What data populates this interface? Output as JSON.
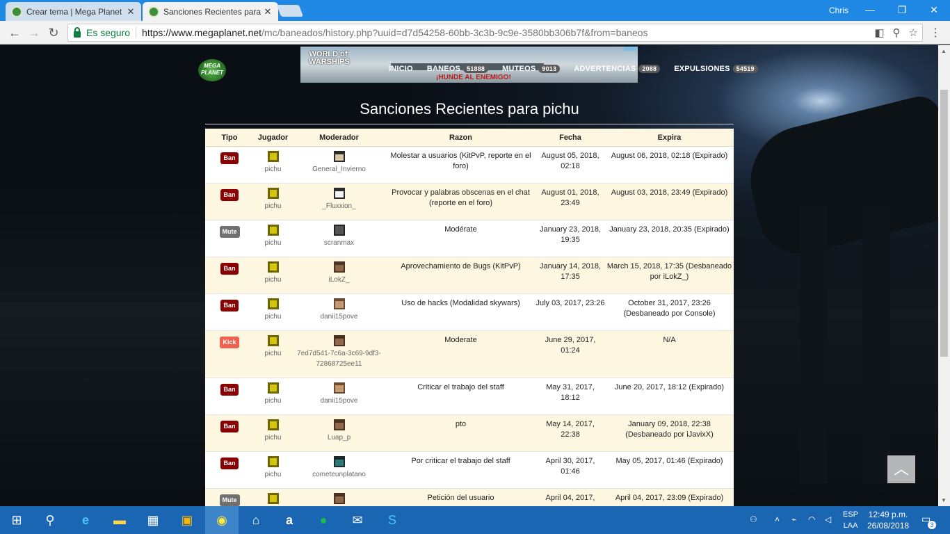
{
  "browser": {
    "tabs": [
      {
        "title": "Crear tema | Mega Planet",
        "close": "✕"
      },
      {
        "title": "Sanciones Recientes para",
        "close": "✕"
      }
    ],
    "user": "Chris",
    "window_controls": {
      "minimize": "—",
      "maximize": "❐",
      "close": "✕"
    },
    "nav": {
      "back": "←",
      "forward": "→",
      "reload": "↻"
    },
    "secure_label": "Es seguro",
    "url_host": "https://www.megaplanet.net",
    "url_path": "/mc/baneados/history.php?uuid=d7d54258-60bb-3c3b-9c9e-3580bb306b7f&from=baneos",
    "menu": "⋮"
  },
  "site": {
    "logo_text": "MEGA PLANET",
    "ad": {
      "logo": "WORLD of WARSHIPS",
      "tagline": "¡HUNDE AL ENEMIGO!"
    },
    "nav": [
      {
        "label": "INICIO",
        "count": ""
      },
      {
        "label": "BANEOS",
        "count": "51888"
      },
      {
        "label": "MUTEOS",
        "count": "9013"
      },
      {
        "label": "ADVERTENCIAS",
        "count": "2088"
      },
      {
        "label": "EXPULSIONES",
        "count": "54519"
      }
    ]
  },
  "page": {
    "title": "Sanciones Recientes para pichu",
    "headers": {
      "tipo": "Tipo",
      "jugador": "Jugador",
      "moderador": "Moderador",
      "razon": "Razon",
      "fecha": "Fecha",
      "expira": "Expira"
    },
    "rows": [
      {
        "tipo": "Ban",
        "jugador": "pichu",
        "moderador": "General_Invierno",
        "razon": "Molestar a usuarios (KitPvP, reporte en el foro)",
        "fecha": "August 05, 2018, 02:18",
        "expira": "August 06, 2018, 02:18 (Expirado)"
      },
      {
        "tipo": "Ban",
        "jugador": "pichu",
        "moderador": "_Fluxxion_",
        "razon": "Provocar y palabras obscenas en el chat (reporte en el foro)",
        "fecha": "August 01, 2018, 23:49",
        "expira": "August 03, 2018, 23:49 (Expirado)"
      },
      {
        "tipo": "Mute",
        "jugador": "pichu",
        "moderador": "scranmax",
        "razon": "Modérate",
        "fecha": "January 23, 2018, 19:35",
        "expira": "January 23, 2018, 20:35 (Expirado)"
      },
      {
        "tipo": "Ban",
        "jugador": "pichu",
        "moderador": "iLokZ_",
        "razon": "Aprovechamiento de Bugs (KitPvP)",
        "fecha": "January 14, 2018, 17:35",
        "expira": "March 15, 2018, 17:35 (Desbaneado por iLokZ_)"
      },
      {
        "tipo": "Ban",
        "jugador": "pichu",
        "moderador": "danii15pove",
        "razon": "Uso de hacks (Modalidad skywars)",
        "fecha": "July 03, 2017, 23:26",
        "expira": "October 31, 2017, 23:26 (Desbaneado por Console)"
      },
      {
        "tipo": "Kick",
        "jugador": "pichu",
        "moderador": "7ed7d541-7c6a-3c69-9df3-72868725ee11",
        "razon": "Moderate",
        "fecha": "June 29, 2017, 01:24",
        "expira": "N/A"
      },
      {
        "tipo": "Ban",
        "jugador": "pichu",
        "moderador": "danii15pove",
        "razon": "Criticar el trabajo del staff",
        "fecha": "May 31, 2017, 18:12",
        "expira": "June 20, 2017, 18:12 (Expirado)"
      },
      {
        "tipo": "Ban",
        "jugador": "pichu",
        "moderador": "Luap_p",
        "razon": "pto",
        "fecha": "May 14, 2017, 22:38",
        "expira": "January 09, 2018, 22:38 (Desbaneado por iJavixX)"
      },
      {
        "tipo": "Ban",
        "jugador": "pichu",
        "moderador": "cometeunplatano",
        "razon": "Por criticar el trabajo del staff",
        "fecha": "April 30, 2017, 01:46",
        "expira": "May 05, 2017, 01:46 (Expirado)"
      },
      {
        "tipo": "Mute",
        "jugador": "",
        "moderador": "",
        "razon": "Petición del usuario",
        "fecha": "April 04, 2017,",
        "expira": "April 04, 2017, 23:09 (Expirado)"
      }
    ],
    "scroll_top": "︿"
  },
  "taskbar": {
    "start": "⊞",
    "search": "⚲",
    "tray": {
      "lang_1": "ESP",
      "lang_2": "LAA",
      "time": "12:49 p.m.",
      "date": "26/08/2018",
      "notifications": "3"
    }
  },
  "colors": {
    "ban": "#8b0000",
    "mute": "#707070",
    "kick": "#f0604e",
    "row_alt": "#fdf6e0",
    "taskbar": "#1a66b3"
  }
}
